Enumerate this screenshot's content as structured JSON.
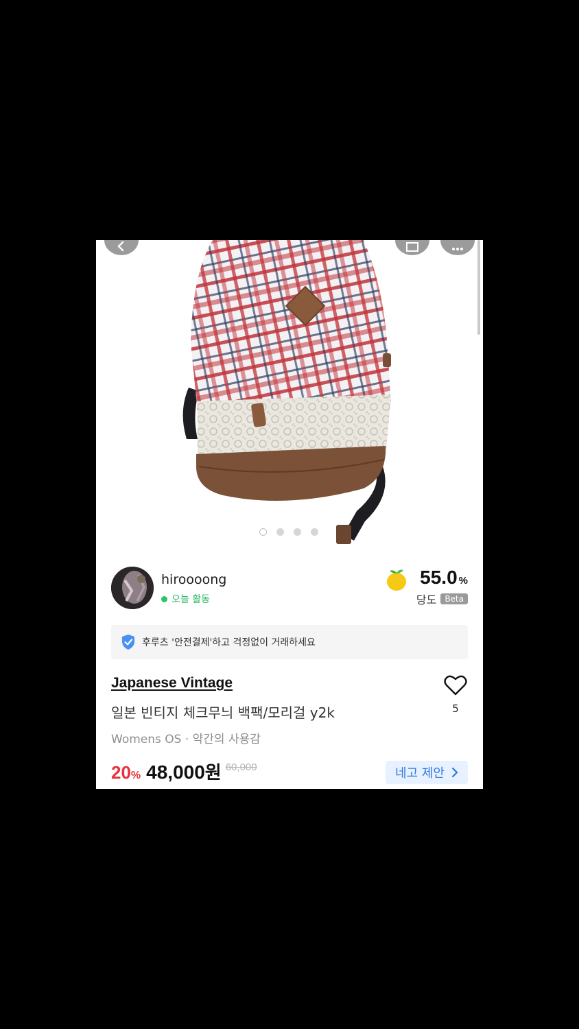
{
  "seller": {
    "name": "hiroooong",
    "activity": "오늘 활동",
    "sweetness_value": "55.0",
    "sweetness_unit": "%",
    "sweetness_label": "당도",
    "beta_badge": "Beta"
  },
  "gallery": {
    "image_count": 4,
    "active_index": 0
  },
  "safe_pay": {
    "text": "후루츠 '안전결제'하고 걱정없이 거래하세요"
  },
  "product": {
    "brand": "Japanese Vintage",
    "title": "일본 빈티지 체크무늬 백팩/모리걸 y2k",
    "meta": "Womens OS · 약간의 사용감",
    "likes": "5"
  },
  "price": {
    "discount": "20",
    "discount_unit": "%",
    "current": "48,000",
    "currency": "원",
    "original": "60,000",
    "offer_label": "네고 제안"
  },
  "colors": {
    "accent_red": "#e8313a",
    "accent_blue": "#2f78e6",
    "online_green": "#2fc16c"
  },
  "icons": [
    "back-arrow-icon",
    "share-icon",
    "more-icon",
    "shield-check-icon",
    "lemon-icon",
    "heart-icon",
    "chevron-right-icon"
  ]
}
